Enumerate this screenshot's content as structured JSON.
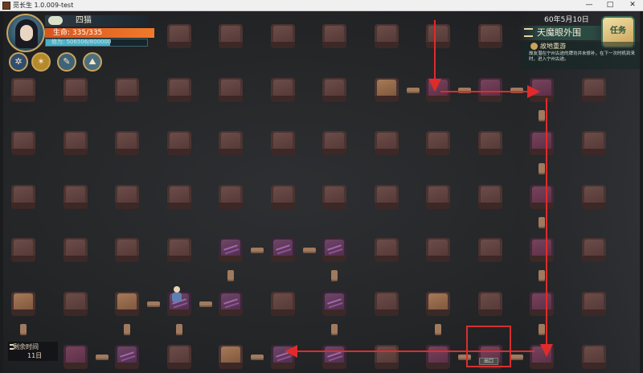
{
  "window": {
    "title": "觅长生 1.0.009-test",
    "minimize": "—",
    "maximize": "□",
    "close": "✕"
  },
  "player": {
    "name": "四猫",
    "hp_text": "生命: 335/335",
    "hp_fraction": 1.0,
    "cultivation_text": "修为: 506506/800000",
    "cultivation_fraction": 0.633
  },
  "skills": [
    {
      "icon": "compass-icon",
      "glyph": "✲"
    },
    {
      "icon": "sword-icon",
      "glyph": "✶"
    },
    {
      "icon": "scroll-icon",
      "glyph": "✎"
    },
    {
      "icon": "map-icon",
      "glyph": "⛰"
    }
  ],
  "world": {
    "date": "60年5月10日",
    "location": "天魔眼外围",
    "quest_label": "任务"
  },
  "mission": {
    "title": "故地重游",
    "description": "故友潜在宁州古迹的牌坊并未修补，在下一次时机到来时，进入宁州古迹。"
  },
  "timer": {
    "label": "剩余时间",
    "value": "11日"
  },
  "map": {
    "exit_label": "出口",
    "route_color": "#e02b2b",
    "tiles": [
      {
        "c": 3,
        "r": 0,
        "k": "normal"
      },
      {
        "c": 4,
        "r": 0,
        "k": "normal"
      },
      {
        "c": 5,
        "r": 0,
        "k": "normal"
      },
      {
        "c": 6,
        "r": 0,
        "k": "normal"
      },
      {
        "c": 7,
        "r": 0,
        "k": "normal"
      },
      {
        "c": 8,
        "r": 0,
        "k": "normal"
      },
      {
        "c": 9,
        "r": 0,
        "k": "normal"
      },
      {
        "c": 0,
        "r": 1,
        "k": "normal"
      },
      {
        "c": 1,
        "r": 1,
        "k": "normal"
      },
      {
        "c": 2,
        "r": 1,
        "k": "normal"
      },
      {
        "c": 3,
        "r": 1,
        "k": "normal"
      },
      {
        "c": 4,
        "r": 1,
        "k": "normal"
      },
      {
        "c": 5,
        "r": 1,
        "k": "normal"
      },
      {
        "c": 6,
        "r": 1,
        "k": "normal"
      },
      {
        "c": 7,
        "r": 1,
        "k": "mountain"
      },
      {
        "c": 8,
        "r": 1,
        "k": "plum"
      },
      {
        "c": 9,
        "r": 1,
        "k": "plum"
      },
      {
        "c": 10,
        "r": 1,
        "k": "plum"
      },
      {
        "c": 11,
        "r": 1,
        "k": "normal"
      },
      {
        "c": 0,
        "r": 2,
        "k": "normal"
      },
      {
        "c": 1,
        "r": 2,
        "k": "normal"
      },
      {
        "c": 2,
        "r": 2,
        "k": "normal"
      },
      {
        "c": 3,
        "r": 2,
        "k": "normal"
      },
      {
        "c": 4,
        "r": 2,
        "k": "normal"
      },
      {
        "c": 5,
        "r": 2,
        "k": "normal"
      },
      {
        "c": 6,
        "r": 2,
        "k": "normal"
      },
      {
        "c": 7,
        "r": 2,
        "k": "normal"
      },
      {
        "c": 8,
        "r": 2,
        "k": "normal"
      },
      {
        "c": 9,
        "r": 2,
        "k": "normal"
      },
      {
        "c": 10,
        "r": 2,
        "k": "plum"
      },
      {
        "c": 11,
        "r": 2,
        "k": "normal"
      },
      {
        "c": 0,
        "r": 3,
        "k": "normal"
      },
      {
        "c": 1,
        "r": 3,
        "k": "normal"
      },
      {
        "c": 2,
        "r": 3,
        "k": "normal"
      },
      {
        "c": 3,
        "r": 3,
        "k": "normal"
      },
      {
        "c": 4,
        "r": 3,
        "k": "normal"
      },
      {
        "c": 5,
        "r": 3,
        "k": "normal"
      },
      {
        "c": 6,
        "r": 3,
        "k": "normal"
      },
      {
        "c": 7,
        "r": 3,
        "k": "normal"
      },
      {
        "c": 8,
        "r": 3,
        "k": "normal"
      },
      {
        "c": 9,
        "r": 3,
        "k": "normal"
      },
      {
        "c": 10,
        "r": 3,
        "k": "plum"
      },
      {
        "c": 11,
        "r": 3,
        "k": "normal"
      },
      {
        "c": 0,
        "r": 4,
        "k": "normal"
      },
      {
        "c": 1,
        "r": 4,
        "k": "normal"
      },
      {
        "c": 2,
        "r": 4,
        "k": "normal"
      },
      {
        "c": 3,
        "r": 4,
        "k": "normal"
      },
      {
        "c": 4,
        "r": 4,
        "k": "void"
      },
      {
        "c": 5,
        "r": 4,
        "k": "void"
      },
      {
        "c": 6,
        "r": 4,
        "k": "void"
      },
      {
        "c": 7,
        "r": 4,
        "k": "normal"
      },
      {
        "c": 8,
        "r": 4,
        "k": "normal"
      },
      {
        "c": 9,
        "r": 4,
        "k": "normal"
      },
      {
        "c": 10,
        "r": 4,
        "k": "plum"
      },
      {
        "c": 11,
        "r": 4,
        "k": "normal"
      },
      {
        "c": 0,
        "r": 5,
        "k": "mountain"
      },
      {
        "c": 1,
        "r": 5,
        "k": "normal"
      },
      {
        "c": 2,
        "r": 5,
        "k": "mountain"
      },
      {
        "c": 3,
        "r": 5,
        "k": "void"
      },
      {
        "c": 4,
        "r": 5,
        "k": "void"
      },
      {
        "c": 5,
        "r": 5,
        "k": "normal"
      },
      {
        "c": 6,
        "r": 5,
        "k": "void"
      },
      {
        "c": 7,
        "r": 5,
        "k": "normal"
      },
      {
        "c": 8,
        "r": 5,
        "k": "mountain"
      },
      {
        "c": 9,
        "r": 5,
        "k": "normal"
      },
      {
        "c": 10,
        "r": 5,
        "k": "plum"
      },
      {
        "c": 11,
        "r": 5,
        "k": "normal"
      },
      {
        "c": 1,
        "r": 6,
        "k": "plum"
      },
      {
        "c": 2,
        "r": 6,
        "k": "void"
      },
      {
        "c": 3,
        "r": 6,
        "k": "normal"
      },
      {
        "c": 4,
        "r": 6,
        "k": "mountain"
      },
      {
        "c": 5,
        "r": 6,
        "k": "void"
      },
      {
        "c": 6,
        "r": 6,
        "k": "void"
      },
      {
        "c": 7,
        "r": 6,
        "k": "normal"
      },
      {
        "c": 8,
        "r": 6,
        "k": "plum"
      },
      {
        "c": 9,
        "r": 6,
        "k": "plum"
      },
      {
        "c": 10,
        "r": 6,
        "k": "plum"
      },
      {
        "c": 11,
        "r": 6,
        "k": "normal"
      }
    ],
    "bridges": [
      {
        "c": 7,
        "r": 1,
        "d": "h"
      },
      {
        "c": 8,
        "r": 1,
        "d": "h"
      },
      {
        "c": 9,
        "r": 1,
        "d": "h"
      },
      {
        "c": 10,
        "r": 1,
        "d": "v"
      },
      {
        "c": 10,
        "r": 2,
        "d": "v"
      },
      {
        "c": 10,
        "r": 3,
        "d": "v"
      },
      {
        "c": 10,
        "r": 4,
        "d": "v"
      },
      {
        "c": 10,
        "r": 5,
        "d": "v"
      },
      {
        "c": 4,
        "r": 4,
        "d": "h"
      },
      {
        "c": 5,
        "r": 4,
        "d": "h"
      },
      {
        "c": 4,
        "r": 4,
        "d": "v"
      },
      {
        "c": 6,
        "r": 4,
        "d": "v"
      },
      {
        "c": 2,
        "r": 5,
        "d": "h"
      },
      {
        "c": 3,
        "r": 5,
        "d": "h"
      },
      {
        "c": 3,
        "r": 5,
        "d": "v"
      },
      {
        "c": 6,
        "r": 5,
        "d": "v"
      },
      {
        "c": 2,
        "r": 5,
        "d": "v"
      },
      {
        "c": 8,
        "r": 5,
        "d": "v"
      },
      {
        "c": 1,
        "r": 6,
        "d": "h"
      },
      {
        "c": 4,
        "r": 6,
        "d": "h"
      },
      {
        "c": 8,
        "r": 6,
        "d": "h"
      },
      {
        "c": 9,
        "r": 6,
        "d": "h"
      },
      {
        "c": 0,
        "r": 5,
        "d": "v"
      }
    ]
  }
}
